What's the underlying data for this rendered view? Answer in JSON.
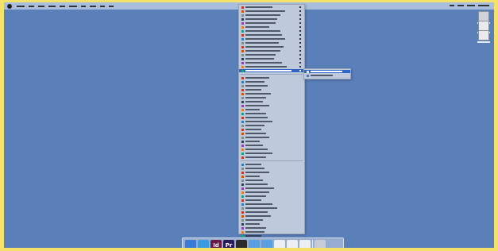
{
  "desktop_icons": [
    {
      "icon": "hard-drive-icon",
      "label": ""
    },
    {
      "icon": "drive-icon",
      "label": ""
    },
    {
      "icon": "drive-icon",
      "label": ""
    }
  ],
  "app_menu": {
    "highlighted_index": 16,
    "submenu_items": [
      {
        "label": ""
      },
      {
        "label": ""
      }
    ]
  },
  "dock": {
    "items": [
      {
        "name": "finder",
        "icon": "finder-icon",
        "label": "",
        "color": "#3a7bd5"
      },
      {
        "name": "safari",
        "icon": "safari-icon",
        "label": "",
        "color": "#3b9be0"
      },
      {
        "name": "indesign",
        "icon": "indesign-icon",
        "label": "Id",
        "color": "#6b1846"
      },
      {
        "name": "premiere",
        "icon": "premiere-icon",
        "label": "Pr",
        "color": "#2b1a5a"
      },
      {
        "name": "app5",
        "icon": "app-icon",
        "label": "",
        "color": "#2b2b2b"
      },
      {
        "name": "folder1",
        "icon": "folder-icon",
        "label": "",
        "color": "#5aa0e0"
      },
      {
        "name": "folder2",
        "icon": "folder-icon",
        "label": "",
        "color": "#5aa0e0"
      },
      {
        "name": "doc1",
        "icon": "document-icon",
        "label": "",
        "color": "#eceff3"
      },
      {
        "name": "doc2",
        "icon": "document-icon",
        "label": "",
        "color": "#eceff3"
      },
      {
        "name": "doc3",
        "icon": "document-icon",
        "label": "",
        "color": "#eceff3"
      },
      {
        "name": "trash",
        "icon": "trash-icon",
        "label": "",
        "color": "#c7ccd4"
      }
    ]
  },
  "colors": {
    "desktop": "#5a7fb9",
    "frame": "#f4e26a",
    "menu_bg": "#bfc9dc",
    "highlight": "#3064c8"
  }
}
